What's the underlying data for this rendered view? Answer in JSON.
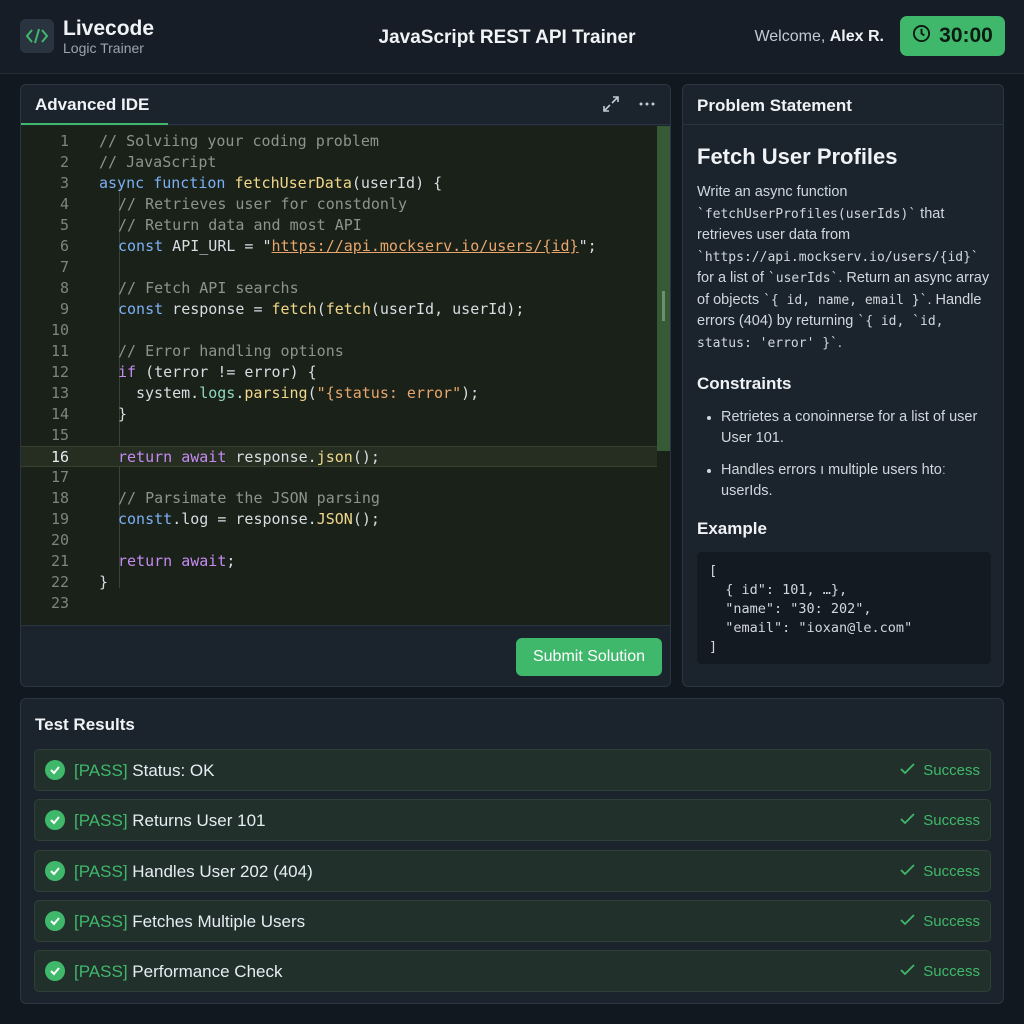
{
  "header": {
    "brand_name": "Livecode",
    "brand_sub": "Logic Trainer",
    "app_title": "JavaScript REST API Trainer",
    "welcome_prefix": "Welcome, ",
    "user_name": "Alex R.",
    "timer": "30:00"
  },
  "ide": {
    "tab_label": "Advanced IDE",
    "submit_label": "Submit Solution",
    "active_line": 16,
    "lines": [
      {
        "n": "1"
      },
      {
        "n": "2"
      },
      {
        "n": "3"
      },
      {
        "n": "4"
      },
      {
        "n": "5"
      },
      {
        "n": "6"
      },
      {
        "n": "7"
      },
      {
        "n": "8"
      },
      {
        "n": "9"
      },
      {
        "n": "10"
      },
      {
        "n": "11"
      },
      {
        "n": "12"
      },
      {
        "n": "13"
      },
      {
        "n": "14"
      },
      {
        "n": "15"
      },
      {
        "n": "16"
      },
      {
        "n": "17"
      },
      {
        "n": "18"
      },
      {
        "n": "19"
      },
      {
        "n": "20"
      },
      {
        "n": "21"
      },
      {
        "n": "22"
      },
      {
        "n": "23"
      }
    ],
    "code": {
      "l1": "// Solviing your coding problem",
      "l2": "// JavaScript",
      "l3_kw": "async",
      "l3_kw2": "function",
      "l3_fn": "fetchUserData",
      "l3_rest": "(userId) {",
      "l4": "// Retrieves user for constdonly",
      "l5": "// Return data and most API",
      "l6_kw": "const",
      "l6_mid": " API_URL = \"",
      "l6_url": "https://api.mockserv.io/users/{id}",
      "l6_end": "\";",
      "l8": "// Fetch API searchs",
      "l9_kw": "const",
      "l9_mid": " response = ",
      "l9_fn1": "fetch",
      "l9_p": "(",
      "l9_fn2": "fetch",
      "l9_rest": "(userId, userId);",
      "l11": "// Error handling options",
      "l12_kw": "if",
      "l12_rest": " (terror != error) {",
      "l13_a": "system.",
      "l13_prop": "logs",
      "l13_b": ".",
      "l13_fn": "parsing",
      "l13_c": "(",
      "l13_str": "\"{status: error\"",
      "l13_d": ");",
      "l14": "}",
      "l16_kw": "return await",
      "l16_a": " response.",
      "l16_fn": "json",
      "l16_b": "();",
      "l18": "// Parsimate the JSON parsing",
      "l19_kw": "constt",
      "l19_a": ".log = response.",
      "l19_fn": "JSON",
      "l19_b": "();",
      "l21_kw": "return await",
      "l21_b": ";",
      "l22": "}"
    }
  },
  "problem": {
    "header": "Problem Statement",
    "title": "Fetch User Profiles",
    "desc_1": "Write an async function",
    "desc_code_1": "`fetchUserProfiles(userIds)`",
    "desc_2": " that retrieves user data from",
    "desc_code_2": "`https://api.mockserv.io/users/{id}`",
    "desc_3": " for a list of ",
    "desc_code_3": "`userIds`",
    "desc_4": ". Return an async array of objects ",
    "desc_code_4": "`{ id, name, email }`",
    "desc_5": ". Handle errors (404) by returning ",
    "desc_code_5": "`{ id, `id, status: 'error' }`",
    "desc_6": ".",
    "constraints_title": "Constraints",
    "constraints": [
      "Retrietes a conoinnerse for a list of user User 101.",
      "Handles errors ı multiple users htoː userIds."
    ],
    "example_title": "Example",
    "example_code": "[\n  { id\": 101, …},\n  \"name\": \"30: 202\",\n  \"email\": \"ioxan@le.com\"\n]"
  },
  "tests": {
    "title": "Test Results",
    "items": [
      {
        "prefix": "[PASS]",
        "label": " Status: OK",
        "status": "Success"
      },
      {
        "prefix": "[PASS]",
        "label": " Returns User 101",
        "status": "Success"
      },
      {
        "prefix": "[PASS]",
        "label": " Handles User 202 (404)",
        "status": "Success"
      },
      {
        "prefix": "[PASS]",
        "label": " Fetches Multiple Users",
        "status": "Success"
      },
      {
        "prefix": "[PASS]",
        "label": " Performance Check",
        "status": "Success"
      }
    ]
  },
  "colors": {
    "accent": "#3fb86b",
    "background": "#111820",
    "panel": "#1b232d"
  },
  "icons": [
    "code-icon",
    "clock-icon",
    "expand-icon",
    "more-icon",
    "check-circle-icon",
    "check-icon"
  ]
}
